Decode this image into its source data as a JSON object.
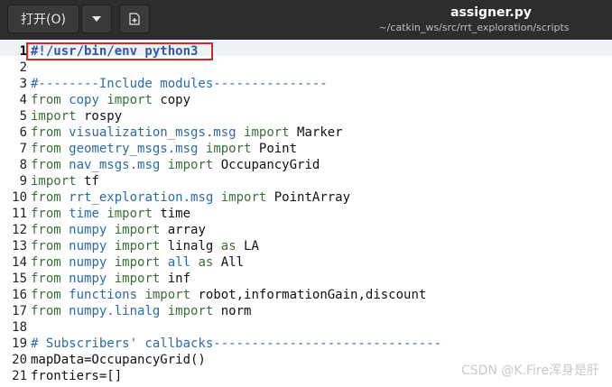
{
  "header": {
    "open_label": "打开(O)",
    "title": "assigner.py",
    "subtitle": "~/catkin_ws/src/rrt_exploration/scripts"
  },
  "icons": [
    "chevron-down-icon",
    "new-document-icon"
  ],
  "lines": [
    {
      "n": "1",
      "parts": [
        {
          "t": "#!/usr/bin/env python3",
          "c": "shebang"
        }
      ]
    },
    {
      "n": "2",
      "parts": []
    },
    {
      "n": "3",
      "parts": [
        {
          "t": "#--------Include modules---------------",
          "c": "cm"
        }
      ]
    },
    {
      "n": "4",
      "parts": [
        {
          "t": "from",
          "c": "kw"
        },
        {
          "t": " "
        },
        {
          "t": "copy",
          "c": "mod"
        },
        {
          "t": " "
        },
        {
          "t": "import",
          "c": "kw"
        },
        {
          "t": " copy"
        }
      ]
    },
    {
      "n": "5",
      "parts": [
        {
          "t": "import",
          "c": "kw"
        },
        {
          "t": " rospy"
        }
      ]
    },
    {
      "n": "6",
      "parts": [
        {
          "t": "from",
          "c": "kw"
        },
        {
          "t": " "
        },
        {
          "t": "visualization_msgs.msg",
          "c": "mod"
        },
        {
          "t": " "
        },
        {
          "t": "import",
          "c": "kw"
        },
        {
          "t": " Marker"
        }
      ]
    },
    {
      "n": "7",
      "parts": [
        {
          "t": "from",
          "c": "kw"
        },
        {
          "t": " "
        },
        {
          "t": "geometry_msgs.msg",
          "c": "mod"
        },
        {
          "t": " "
        },
        {
          "t": "import",
          "c": "kw"
        },
        {
          "t": " Point"
        }
      ]
    },
    {
      "n": "8",
      "parts": [
        {
          "t": "from",
          "c": "kw"
        },
        {
          "t": " "
        },
        {
          "t": "nav_msgs.msg",
          "c": "mod"
        },
        {
          "t": " "
        },
        {
          "t": "import",
          "c": "kw"
        },
        {
          "t": " OccupancyGrid"
        }
      ]
    },
    {
      "n": "9",
      "parts": [
        {
          "t": "import",
          "c": "kw"
        },
        {
          "t": " tf"
        }
      ]
    },
    {
      "n": "10",
      "parts": [
        {
          "t": "from",
          "c": "kw"
        },
        {
          "t": " "
        },
        {
          "t": "rrt_exploration.msg",
          "c": "mod"
        },
        {
          "t": " "
        },
        {
          "t": "import",
          "c": "kw"
        },
        {
          "t": " PointArray"
        }
      ]
    },
    {
      "n": "11",
      "parts": [
        {
          "t": "from",
          "c": "kw"
        },
        {
          "t": " "
        },
        {
          "t": "time",
          "c": "mod"
        },
        {
          "t": " "
        },
        {
          "t": "import",
          "c": "kw"
        },
        {
          "t": " time"
        }
      ]
    },
    {
      "n": "12",
      "parts": [
        {
          "t": "from",
          "c": "kw"
        },
        {
          "t": " "
        },
        {
          "t": "numpy",
          "c": "mod"
        },
        {
          "t": " "
        },
        {
          "t": "import",
          "c": "kw"
        },
        {
          "t": " array"
        }
      ]
    },
    {
      "n": "13",
      "parts": [
        {
          "t": "from",
          "c": "kw"
        },
        {
          "t": " "
        },
        {
          "t": "numpy",
          "c": "mod"
        },
        {
          "t": " "
        },
        {
          "t": "import",
          "c": "kw"
        },
        {
          "t": " linalg "
        },
        {
          "t": "as",
          "c": "kw"
        },
        {
          "t": " LA"
        }
      ]
    },
    {
      "n": "14",
      "parts": [
        {
          "t": "from",
          "c": "kw"
        },
        {
          "t": " "
        },
        {
          "t": "numpy",
          "c": "mod"
        },
        {
          "t": " "
        },
        {
          "t": "import",
          "c": "kw"
        },
        {
          "t": " "
        },
        {
          "t": "all",
          "c": "mod"
        },
        {
          "t": " "
        },
        {
          "t": "as",
          "c": "kw"
        },
        {
          "t": " All"
        }
      ]
    },
    {
      "n": "15",
      "parts": [
        {
          "t": "from",
          "c": "kw"
        },
        {
          "t": " "
        },
        {
          "t": "numpy",
          "c": "mod"
        },
        {
          "t": " "
        },
        {
          "t": "import",
          "c": "kw"
        },
        {
          "t": " inf"
        }
      ]
    },
    {
      "n": "16",
      "parts": [
        {
          "t": "from",
          "c": "kw"
        },
        {
          "t": " "
        },
        {
          "t": "functions",
          "c": "mod"
        },
        {
          "t": " "
        },
        {
          "t": "import",
          "c": "kw"
        },
        {
          "t": " robot,informationGain,discount"
        }
      ]
    },
    {
      "n": "17",
      "parts": [
        {
          "t": "from",
          "c": "kw"
        },
        {
          "t": " "
        },
        {
          "t": "numpy.linalg",
          "c": "mod"
        },
        {
          "t": " "
        },
        {
          "t": "import",
          "c": "kw"
        },
        {
          "t": " norm"
        }
      ]
    },
    {
      "n": "18",
      "parts": []
    },
    {
      "n": "19",
      "parts": [
        {
          "t": "# Subscribers' callbacks------------------------------",
          "c": "cm"
        }
      ]
    },
    {
      "n": "20",
      "parts": [
        {
          "t": "mapData=OccupancyGrid()"
        }
      ]
    },
    {
      "n": "21",
      "parts": [
        {
          "t": "frontiers=[]"
        }
      ]
    }
  ],
  "watermark": "CSDN @K.Fire浑身是肝"
}
